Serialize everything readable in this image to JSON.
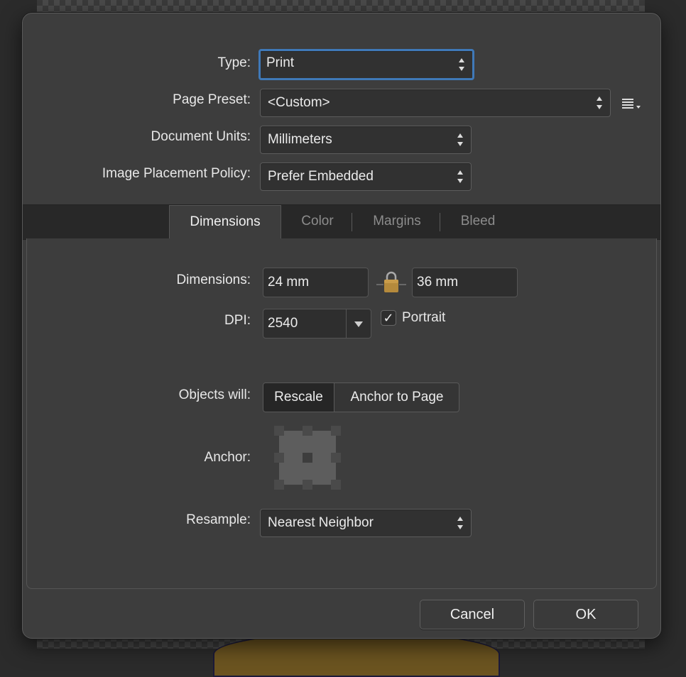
{
  "dialog": {
    "type_label": "Type:",
    "type_value": "Print",
    "page_preset_label": "Page Preset:",
    "page_preset_value": "<Custom>",
    "document_units_label": "Document Units:",
    "document_units_value": "Millimeters",
    "image_placement_label": "Image Placement Policy:",
    "image_placement_value": "Prefer Embedded"
  },
  "tabs": [
    {
      "label": "Dimensions",
      "active": true
    },
    {
      "label": "Color",
      "active": false
    },
    {
      "label": "Margins",
      "active": false
    },
    {
      "label": "Bleed",
      "active": false
    }
  ],
  "dimensions": {
    "label": "Dimensions:",
    "width": "24 mm",
    "height": "36 mm",
    "dpi_label": "DPI:",
    "dpi_value": "2540",
    "portrait_label": "Portrait",
    "portrait_checked": true,
    "objects_label": "Objects will:",
    "objects_options": [
      "Rescale",
      "Anchor to Page"
    ],
    "objects_selected": "Rescale",
    "anchor_label": "Anchor:",
    "resample_label": "Resample:",
    "resample_value": "Nearest Neighbor"
  },
  "buttons": {
    "cancel": "Cancel",
    "ok": "OK"
  },
  "icons": {
    "lock": "lock-icon",
    "preset_menu": "list-menu-icon",
    "checkmark": "✓"
  },
  "colors": {
    "focus_ring": "#3f79b8",
    "lock_gold": "#b58a3c"
  }
}
